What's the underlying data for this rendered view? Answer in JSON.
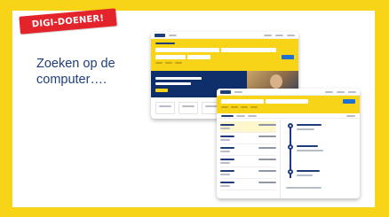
{
  "badge": {
    "label": "DIGI-DOENER!"
  },
  "headline": {
    "text": "Zoeken op de computer…."
  },
  "colors": {
    "frame": "#f7d417",
    "badge": "#e4242b",
    "text": "#1e3d7a",
    "accent_button": "#1e6fd6"
  },
  "icons": [
    "ns-logo",
    "search-button"
  ]
}
